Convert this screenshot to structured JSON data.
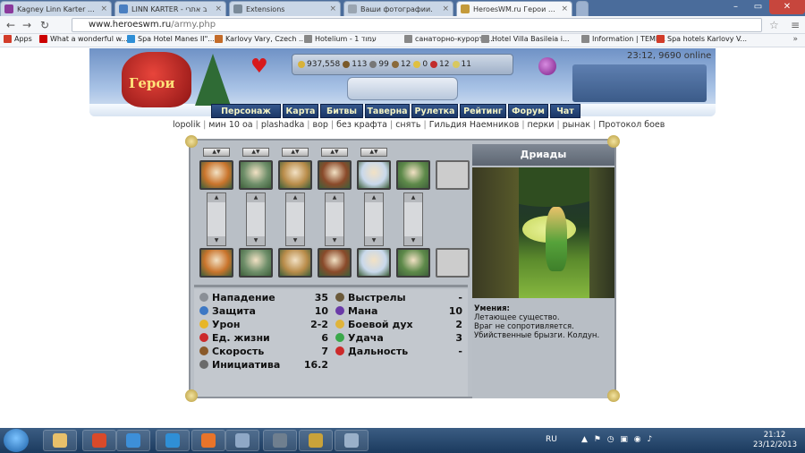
{
  "browser": {
    "tabs": [
      {
        "title": "Kagney Linn Karter beaut",
        "color": "#8b3a9c"
      },
      {
        "title": "LINN KARTER - ב אתרי",
        "color": "#4a7fc1"
      },
      {
        "title": "Extensions",
        "color": "#7a8a99"
      },
      {
        "title": "Ваши фотографии.",
        "color": "#9aa5b1"
      },
      {
        "title": "HeroesWM.ru Герои войн",
        "color": "#c49a3a"
      }
    ],
    "url_host": "www.heroeswm.ru",
    "url_path": "/army.php",
    "bookmarks": [
      {
        "label": "Apps",
        "color": "#d23c2a"
      },
      {
        "label": "What a wonderful w...",
        "color": "#cc0000"
      },
      {
        "label": "Spa Hotel Manes II\"...",
        "color": "#2f8fd6"
      },
      {
        "label": "Karlovy Vary, Czech ...",
        "color": "#c46c2a"
      },
      {
        "label": "Hotelium - 1 עמוד",
        "color": "#888888"
      },
      {
        "label": "санаторно-курортн...",
        "color": "#888888"
      },
      {
        "label": "Hotel Villa Basileia i...",
        "color": "#888888"
      },
      {
        "label": "Information | TEMP...",
        "color": "#888888"
      },
      {
        "label": "Spa hotels Karlovy V...",
        "color": "#d23c2a"
      }
    ],
    "bookmarks_more": "»"
  },
  "header": {
    "logo_text": "Герои",
    "resources": [
      {
        "value": "937,558",
        "color": "#d8b23a"
      },
      {
        "value": "113",
        "color": "#7a5a2a"
      },
      {
        "value": "99",
        "color": "#777777"
      },
      {
        "value": "12",
        "color": "#8a6a3a"
      },
      {
        "value": "0",
        "color": "#e0c040"
      },
      {
        "value": "12",
        "color": "#c22d2d"
      },
      {
        "value": "11",
        "color": "#d8c860"
      }
    ],
    "time_online": "23:12, 9690 online"
  },
  "nav": {
    "main": [
      "Персонаж",
      "Карта",
      "Битвы",
      "Таверна",
      "Рулетка",
      "Рейтинг",
      "Форум",
      "Чат"
    ],
    "sub": [
      "lopolik",
      "мин 10 оа",
      "plashadka",
      "вор",
      "без крафта",
      "снять",
      "Гильдия Наемников",
      "перки",
      "рынак",
      "Протокол боев"
    ]
  },
  "army": {
    "top_row_colors": [
      "#c9742c",
      "#6f8f6a",
      "#b98c4a",
      "#8a4a2a",
      "#c9d9ec",
      "#5e8a4a"
    ],
    "bottom_row_colors": [
      "#c9742c",
      "#6f8f6a",
      "#b98c4a",
      "#8a4a2a",
      "#c9d9ec",
      "#5e8a4a"
    ],
    "stats_left": [
      {
        "label": "Нападение",
        "value": "35",
        "color": "#8a8f96"
      },
      {
        "label": "Защита",
        "value": "10",
        "color": "#3d78c4"
      },
      {
        "label": "Урон",
        "value": "2-2",
        "color": "#e7b628"
      },
      {
        "label": "Ед. жизни",
        "value": "6",
        "color": "#cc2a2a"
      },
      {
        "label": "Скорость",
        "value": "7",
        "color": "#8a5a2a"
      },
      {
        "label": "Инициатива",
        "value": "16.2",
        "color": "#6a6a6a"
      }
    ],
    "stats_right": [
      {
        "label": "Выстрелы",
        "value": "-",
        "color": "#6b5a3a"
      },
      {
        "label": "Мана",
        "value": "10",
        "color": "#6a3aa8"
      },
      {
        "label": "Боевой дух",
        "value": "2",
        "color": "#e0b43a"
      },
      {
        "label": "Удача",
        "value": "3",
        "color": "#3aa84a"
      },
      {
        "label": "Дальность",
        "value": "-",
        "color": "#cc2a2a"
      }
    ],
    "creature": {
      "name": "Дриады",
      "abilities_title": "Умения:",
      "abilities": [
        "Летающее существо.",
        "Враг не сопротивляется.",
        "Убийственные брызги.  Колдун."
      ]
    }
  },
  "taskbar": {
    "apps": [
      "#e8c06a",
      "#d84a2a",
      "#3d8fd8",
      "#2f8fd6",
      "#e8742a",
      "#8fa8c6",
      "#6f7f8f",
      "#c9a23a",
      "#9ab0c9"
    ],
    "lang": "RU",
    "clock_time": "21:12",
    "clock_date": "23/12/2013"
  }
}
